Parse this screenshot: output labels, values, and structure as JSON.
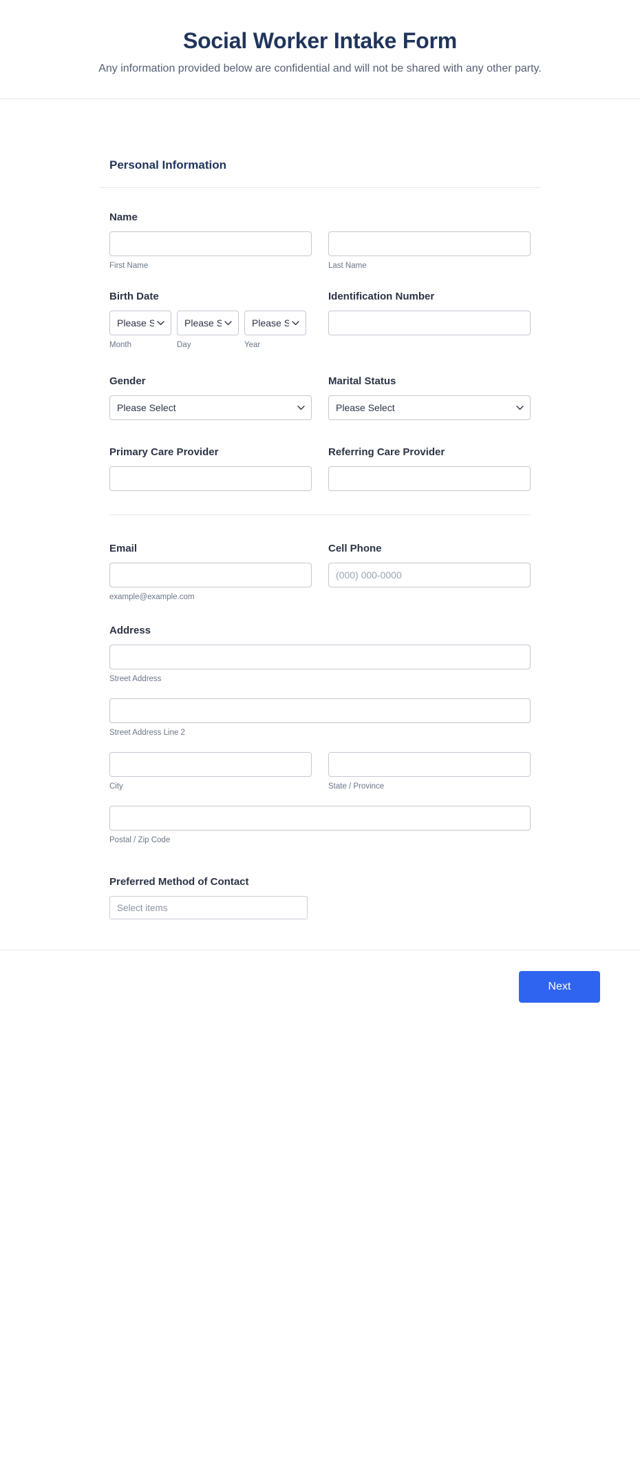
{
  "header": {
    "title": "Social Worker Intake Form",
    "subtitle": "Any information provided below are confidential and will not be shared with any other party."
  },
  "section": {
    "heading": "Personal Information"
  },
  "fields": {
    "name": {
      "label": "Name",
      "first_sub": "First Name",
      "last_sub": "Last Name",
      "first_value": "",
      "last_value": ""
    },
    "birth_date": {
      "label": "Birth Date",
      "month_selected": "Please Select",
      "day_selected": "Please Select",
      "year_selected": "Please Select",
      "month_sub": "Month",
      "day_sub": "Day",
      "year_sub": "Year"
    },
    "identification_number": {
      "label": "Identification Number",
      "value": ""
    },
    "gender": {
      "label": "Gender",
      "selected": "Please Select"
    },
    "marital_status": {
      "label": "Marital Status",
      "selected": "Please Select"
    },
    "primary_care_provider": {
      "label": "Primary Care Provider",
      "value": ""
    },
    "referring_care_provider": {
      "label": "Referring Care Provider",
      "value": ""
    },
    "email": {
      "label": "Email",
      "value": "",
      "sub": "example@example.com"
    },
    "cell_phone": {
      "label": "Cell Phone",
      "placeholder": "(000) 000-0000",
      "value": ""
    },
    "address": {
      "label": "Address",
      "street_sub": "Street Address",
      "street2_sub": "Street Address Line 2",
      "city_sub": "City",
      "state_sub": "State / Province",
      "postal_sub": "Postal / Zip Code",
      "street_value": "",
      "street2_value": "",
      "city_value": "",
      "state_value": "",
      "postal_value": ""
    },
    "preferred_contact": {
      "label": "Preferred Method of Contact",
      "placeholder": "Select items"
    }
  },
  "footer": {
    "next_label": "Next"
  },
  "colors": {
    "accent": "#2f64f0",
    "title": "#21355b",
    "text": "#2c3345",
    "muted": "#6b7587",
    "border": "#c3c8d1",
    "rule": "#e6e8ec"
  }
}
